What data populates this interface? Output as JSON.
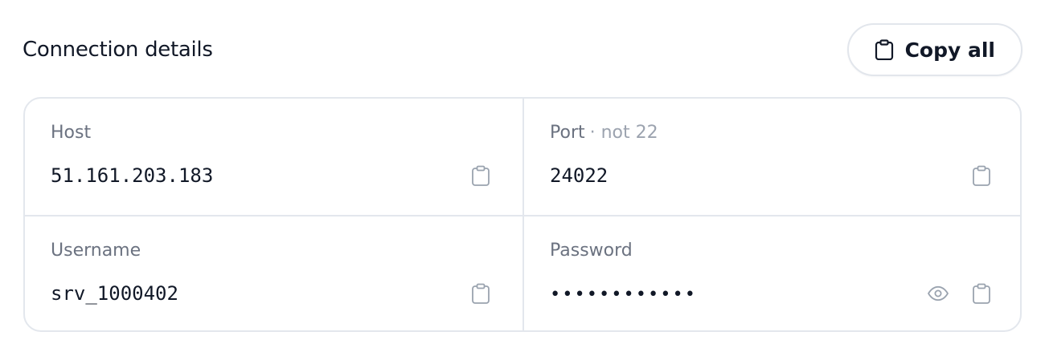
{
  "header": {
    "title": "Connection details",
    "copy_all_label": "Copy all"
  },
  "fields": {
    "host": {
      "label": "Host",
      "value": "51.161.203.183"
    },
    "port": {
      "label": "Port",
      "hint": "· not 22",
      "value": "24022"
    },
    "username": {
      "label": "Username",
      "value": "srv_1000402"
    },
    "password": {
      "label": "Password",
      "value": "••••••••••••"
    }
  },
  "icons": {
    "copy": "clipboard-icon",
    "reveal": "eye-icon"
  },
  "colors": {
    "text": "#111827",
    "muted": "#6b7280",
    "hint": "#9ca3af",
    "border": "#e3e7ed",
    "icon": "#9aa3af"
  }
}
